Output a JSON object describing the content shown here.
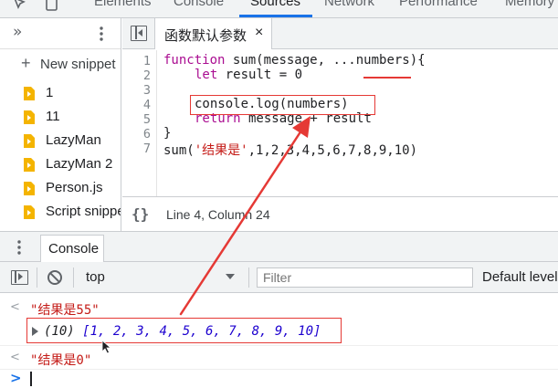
{
  "devtools": {
    "tabs": [
      "Elements",
      "Console",
      "Sources",
      "Network",
      "Performance",
      "Memory"
    ],
    "active_tab": "Sources"
  },
  "navigator": {
    "new_snippet_label": "New snippet",
    "files": [
      "1",
      "11",
      "LazyMan",
      "LazyMan 2",
      "Person.js",
      "Script snippet"
    ]
  },
  "editor": {
    "file_tab": "函数默认参数",
    "close_glyph": "×",
    "line_numbers": [
      "1",
      "2",
      "3",
      "4",
      "5",
      "6",
      "7"
    ],
    "code": {
      "l1_kw": "function",
      "l1_rest": " sum(message, ...numbers){",
      "l2_kw": "let",
      "l2_rest": " result = 0",
      "l4": "console.log(numbers)",
      "l5_kw": "return",
      "l5_rest": " message + result",
      "l6": "}",
      "l7_fn": "sum(",
      "l7_str": "'结果是'",
      "l7_args": ",1,2,3,4,5,6,7,8,9,10)"
    },
    "status": {
      "braces": "{}",
      "position": "Line 4, Column 24"
    }
  },
  "drawer": {
    "tab": "Console",
    "context": "top",
    "filter_placeholder": "Filter",
    "levels": "Default levels"
  },
  "console_output": {
    "log1": "\"结果是55\"",
    "array_count": "(10)",
    "array_values": "[1, 2, 3, 4, 5, 6, 7, 8, 9, 10]",
    "log2": "\"结果是0\"",
    "prompt": ">"
  },
  "annotation_color": "#e53935"
}
